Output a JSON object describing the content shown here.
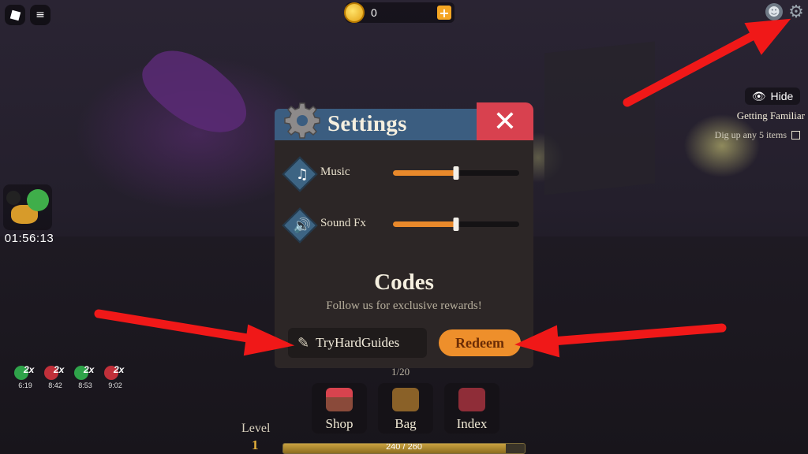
{
  "hud": {
    "coins": "0",
    "hide_label": "Hide",
    "quest_title": "Getting Familiar",
    "quest_desc": "Dig up any 5 items",
    "boost_timer": "01:56:13",
    "buffs": [
      {
        "icon": "clover-icon",
        "mult": "2x",
        "time": "6:19",
        "color": "#2fa34a"
      },
      {
        "icon": "magnet-icon",
        "mult": "2x",
        "time": "8:42",
        "color": "#c0303a"
      },
      {
        "icon": "clover-icon",
        "mult": "2x",
        "time": "8:53",
        "color": "#2fa34a"
      },
      {
        "icon": "magnet-icon",
        "mult": "2x",
        "time": "9:02",
        "color": "#c0303a"
      }
    ],
    "inventory_count": "1/20",
    "hotbar": [
      {
        "label": "Shop",
        "icon": "shop-icon"
      },
      {
        "label": "Bag",
        "icon": "bag-icon"
      },
      {
        "label": "Index",
        "icon": "book-icon"
      }
    ],
    "level_label": "Level",
    "level": "1",
    "xp_text": "240 / 260",
    "xp_fraction": 0.92
  },
  "settings": {
    "title": "Settings",
    "rows": [
      {
        "label": "Music",
        "icon": "music-note-icon",
        "value": 0.5
      },
      {
        "label": "Sound Fx",
        "icon": "speaker-icon",
        "value": 0.5
      }
    ],
    "codes_title": "Codes",
    "codes_subtitle": "Follow us for exclusive rewards!",
    "code_value": "TryHardGuides",
    "redeem_label": "Redeem"
  },
  "colors": {
    "header_blue": "#3b5d80",
    "close_red": "#d8414f",
    "accent_orange": "#ee8f2b",
    "arrow_red": "#f01818"
  }
}
